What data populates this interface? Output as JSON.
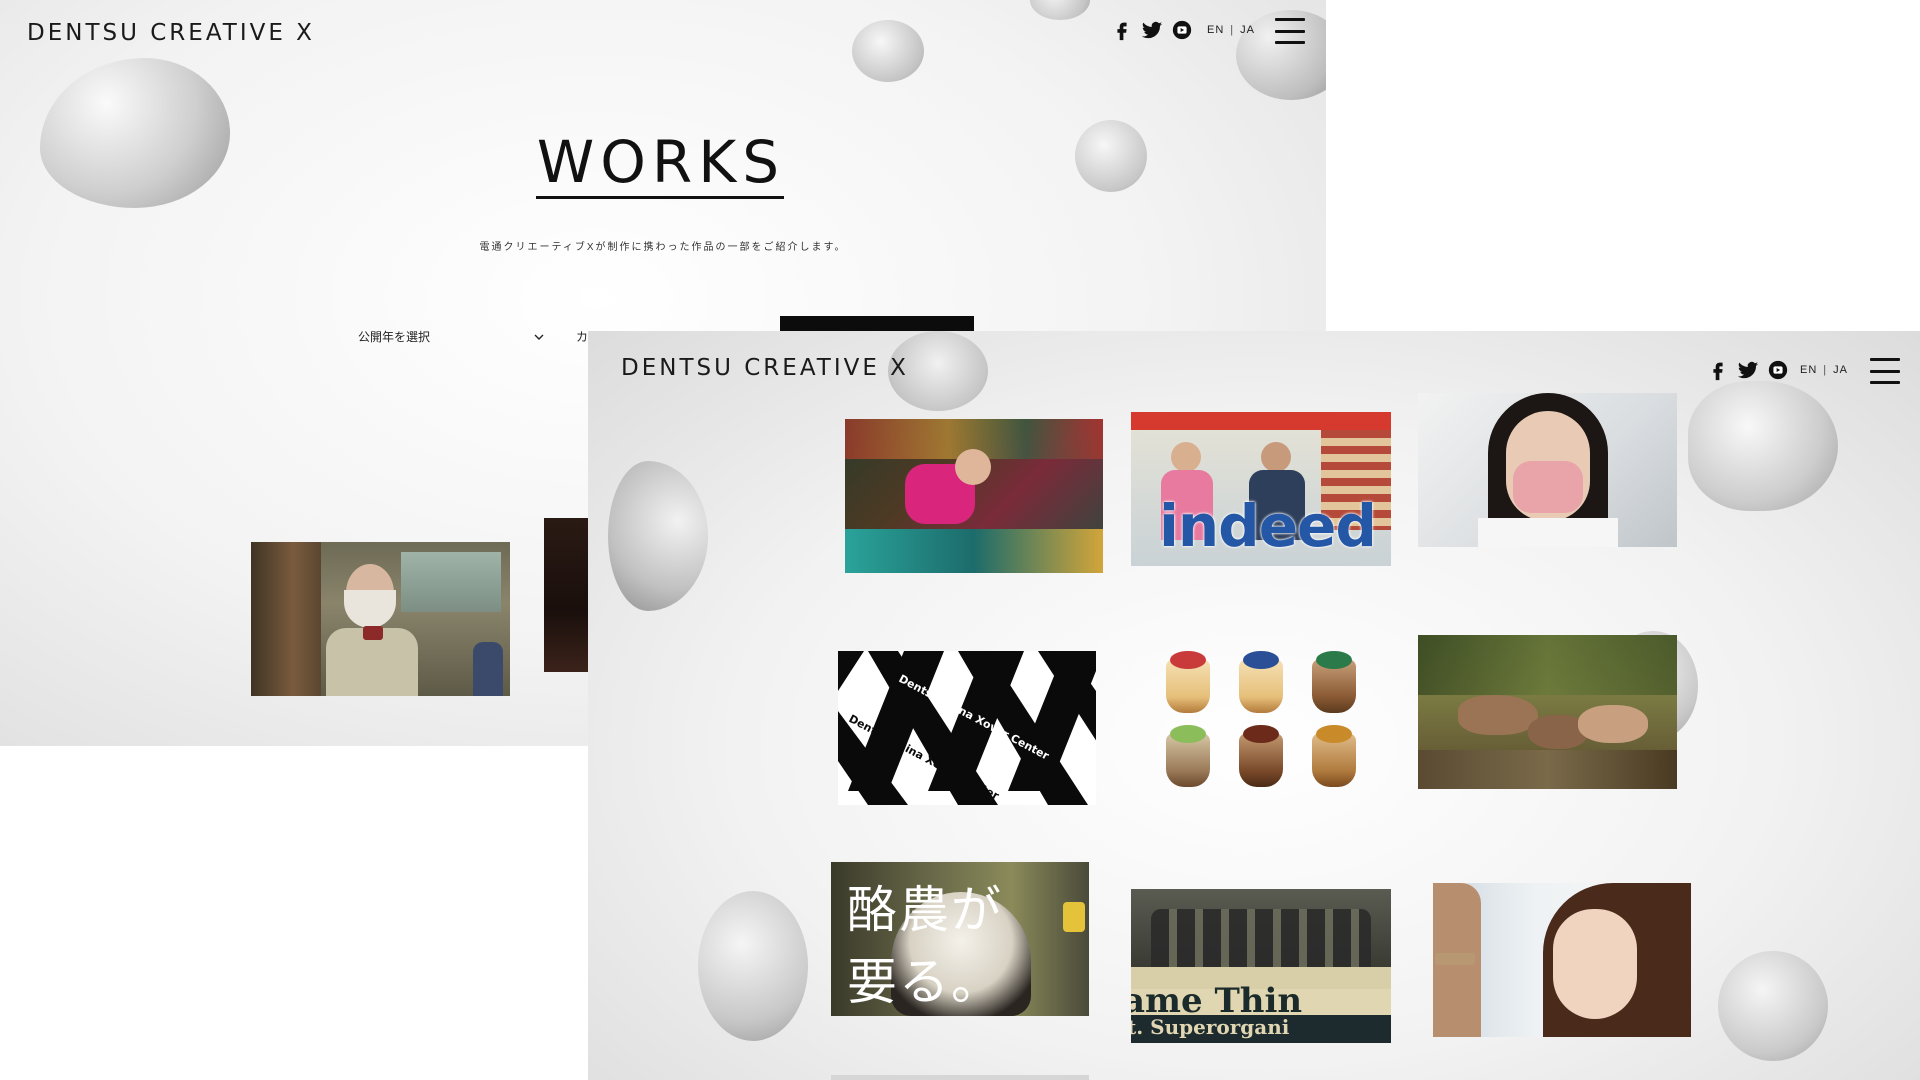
{
  "back_page": {
    "brand": "DENTSU CREATIVE X",
    "social": [
      "facebook-icon",
      "twitter-icon",
      "youtube-icon"
    ],
    "lang": {
      "en": "EN",
      "sep": "|",
      "ja": "JA"
    },
    "title": "WORKS",
    "description": "電通クリエーティブXが制作に携わった作品の一部をご紹介します。",
    "filter_year": "公開年を選択",
    "filter_category": "カ"
  },
  "front_page": {
    "brand": "DENTSU CREATIVE X",
    "social": [
      "facebook-icon",
      "twitter-icon",
      "youtube-icon"
    ],
    "lang": {
      "en": "EN",
      "sep": "|",
      "ja": "JA"
    },
    "cards": {
      "indeed_logo": "indeed",
      "cxc_pattern_text": "Dentsu China Xover Center",
      "rakuno_line1": "酪農が",
      "rakuno_line2": "要る。",
      "band_line1": "ame Thin",
      "band_line2": "t. Superorgani"
    }
  },
  "colors": {
    "indeed_blue": "#2557a7",
    "black": "#111111"
  }
}
